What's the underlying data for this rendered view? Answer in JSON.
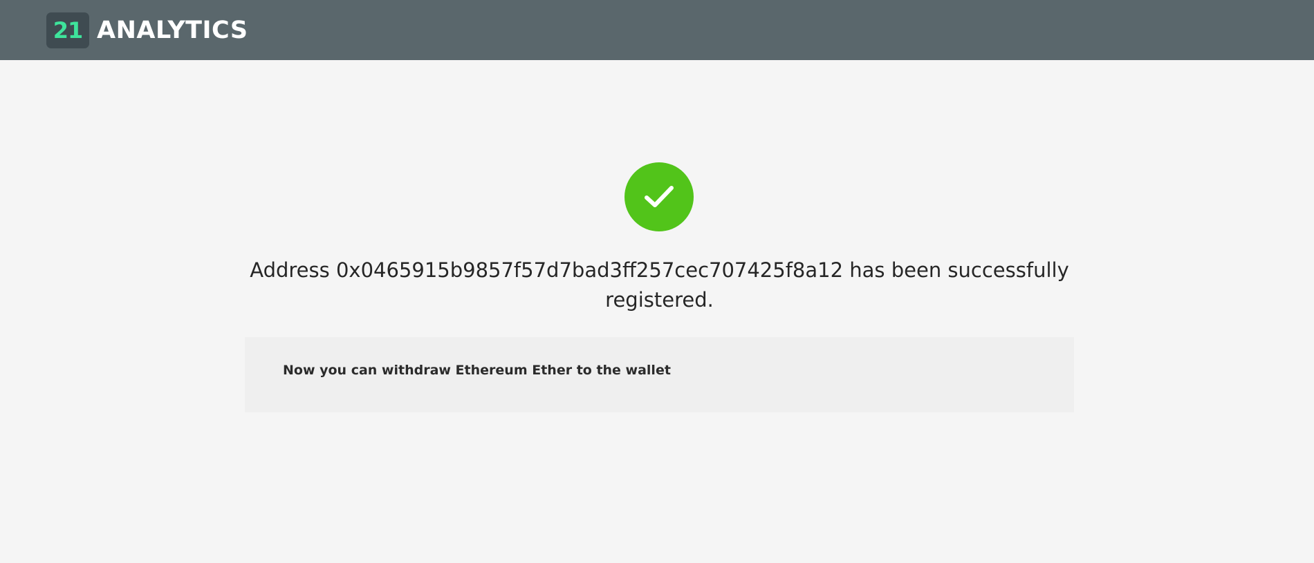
{
  "header": {
    "logo_badge_text": "21",
    "brand_name": "ANALYTICS",
    "logo_accent_color": "#3ee39b",
    "background_color": "#5a676c"
  },
  "result": {
    "status_icon": "check-circle-icon",
    "status_color": "#52c41a",
    "message": "Address 0x0465915b9857f57d7bad3ff257cec707425f8a12 has been successfully registered.",
    "info_text": "Now you can withdraw Ethereum Ether to the wallet"
  }
}
